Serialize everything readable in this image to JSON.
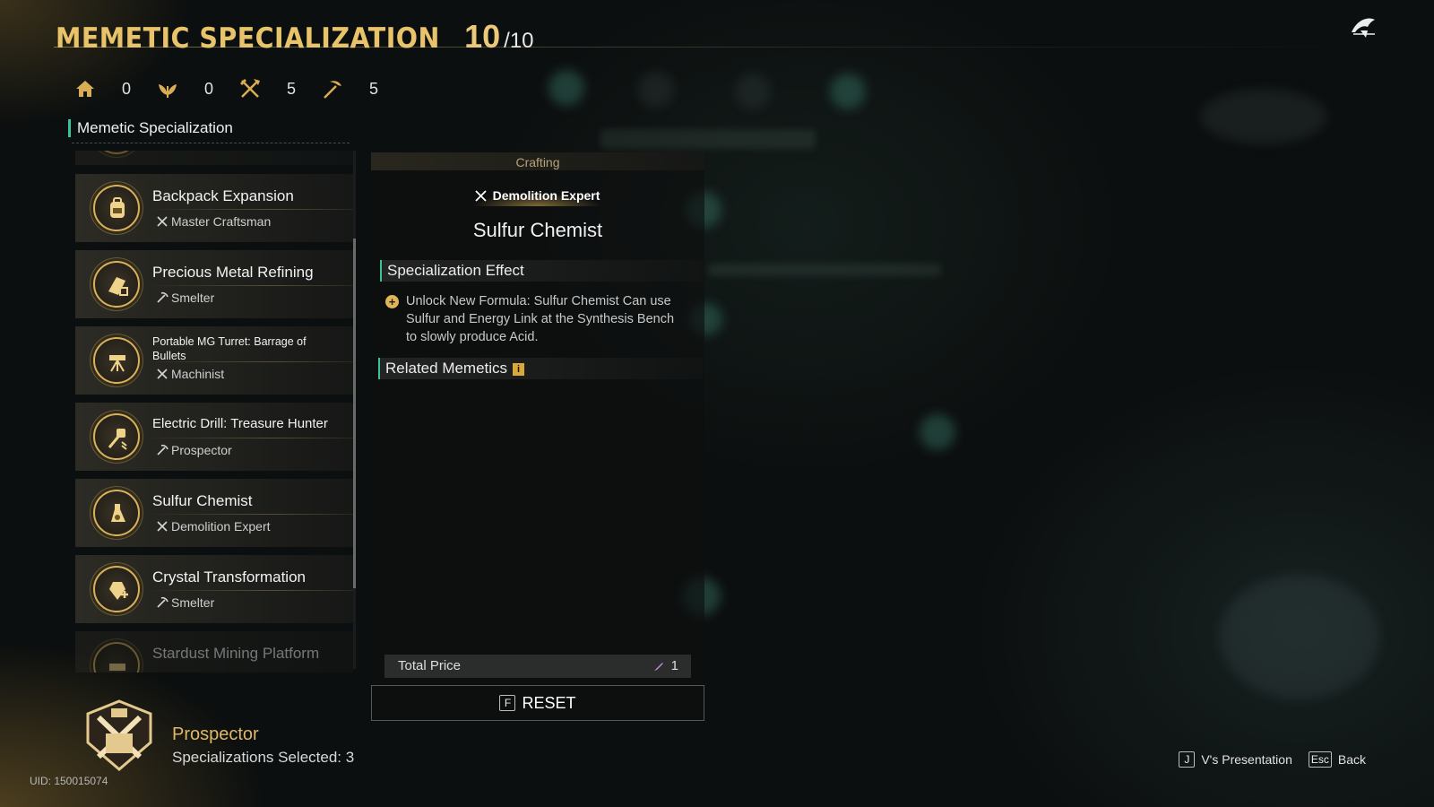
{
  "header": {
    "title": "MEMETIC SPECIALIZATION",
    "current": "10",
    "max": "/10"
  },
  "counters": [
    {
      "icon": "home-icon",
      "value": "0"
    },
    {
      "icon": "leaf-icon",
      "value": "0"
    },
    {
      "icon": "crossed-tools-icon",
      "value": "5"
    },
    {
      "icon": "pickaxe-icon",
      "value": "5"
    }
  ],
  "list": {
    "section_title": "Memetic Specialization",
    "items": [
      {
        "name": "Backpack Expansion",
        "class": "Master Craftsman",
        "class_icon": "crossed-tools-icon",
        "icon": "backpack-icon"
      },
      {
        "name": "Precious Metal Refining",
        "class": "Smelter",
        "class_icon": "pickaxe-icon",
        "icon": "ingot-icon"
      },
      {
        "name": "Portable MG Turret: Barrage of Bullets",
        "class": "Machinist",
        "class_icon": "crossed-tools-icon",
        "icon": "turret-icon"
      },
      {
        "name": "Electric Drill: Treasure Hunter",
        "class": "Prospector",
        "class_icon": "pickaxe-icon",
        "icon": "drill-icon"
      },
      {
        "name": "Sulfur Chemist",
        "class": "Demolition Expert",
        "class_icon": "crossed-tools-icon",
        "icon": "flask-icon"
      },
      {
        "name": "Crystal Transformation",
        "class": "Smelter",
        "class_icon": "pickaxe-icon",
        "icon": "crystal-icon"
      },
      {
        "name": "Stardust Mining Platform",
        "class": "",
        "class_icon": "",
        "icon": "platform-icon"
      }
    ]
  },
  "detail": {
    "category": "Crafting",
    "class_tag": "Demolition Expert",
    "title": "Sulfur Chemist",
    "effect_heading": "Specialization Effect",
    "effect_text": "Unlock New Formula: Sulfur Chemist Can use Sulfur and Energy Link at the Synthesis Bench to slowly produce Acid.",
    "related_heading": "Related Memetics",
    "total_label": "Total Price",
    "total_value": "1",
    "reset_key": "F",
    "reset_label": "RESET"
  },
  "profile": {
    "name": "Prospector",
    "selected": "Specializations Selected: 3",
    "uid": "UID: 150015074"
  },
  "hints": [
    {
      "key": "J",
      "label": "V's Presentation"
    },
    {
      "key": "Esc",
      "label": "Back"
    }
  ],
  "colors": {
    "accent_gold": "#e8c36a",
    "accent_teal": "#39c29c",
    "background": "#0c0f0f"
  }
}
